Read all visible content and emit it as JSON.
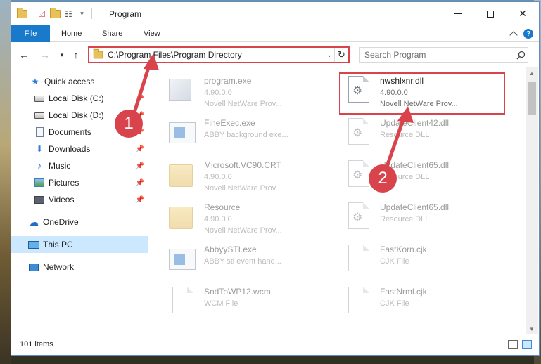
{
  "window": {
    "title": "Program",
    "minimize": "—",
    "maximize": "☐",
    "close": "✕"
  },
  "ribbon": {
    "file": "File",
    "home": "Home",
    "share": "Share",
    "view": "View"
  },
  "address": {
    "path": "C:\\Program Files\\Program Directory",
    "search_placeholder": "Search Program"
  },
  "sidebar": {
    "items": [
      {
        "label": "Quick access",
        "icon": "star-icon"
      },
      {
        "label": "Local Disk (C:)",
        "icon": "disk-icon"
      },
      {
        "label": "Local Disk (D:)",
        "icon": "disk-icon"
      },
      {
        "label": "Documents",
        "icon": "documents-icon"
      },
      {
        "label": "Downloads",
        "icon": "downloads-icon"
      },
      {
        "label": "Music",
        "icon": "music-icon"
      },
      {
        "label": "Pictures",
        "icon": "pictures-icon"
      },
      {
        "label": "Videos",
        "icon": "videos-icon"
      },
      {
        "label": "OneDrive",
        "icon": "cloud-icon"
      },
      {
        "label": "This PC",
        "icon": "computer-icon"
      },
      {
        "label": "Network",
        "icon": "network-icon"
      }
    ]
  },
  "files": [
    {
      "name": "program.exe",
      "line2": "4.90.0.0",
      "line3": "Novell NetWare Prov...",
      "icon": "exe-icon"
    },
    {
      "name": "nwshlxnr.dll",
      "line2": "4.90.0.0",
      "line3": "Novell NetWare Prov...",
      "icon": "dll-icon"
    },
    {
      "name": "FineExec.exe",
      "line2": "ABBY background exe...",
      "line3": "",
      "icon": "app-icon"
    },
    {
      "name": "UpdateClient42.dll",
      "line2": "Resource DLL",
      "line3": "",
      "icon": "dll-icon"
    },
    {
      "name": "Microsoft.VC90.CRT",
      "line2": "4.90.0.0",
      "line3": "Novell NetWare Prov...",
      "icon": "folder-icon"
    },
    {
      "name": "UpdateClient65.dll",
      "line2": "Resource DLL",
      "line3": "",
      "icon": "dll-icon"
    },
    {
      "name": "Resource",
      "line2": "4.90.0.0",
      "line3": "Novell NetWare Prov...",
      "icon": "folder-icon"
    },
    {
      "name": "UpdateClient65.dll",
      "line2": "Resource DLL",
      "line3": "",
      "icon": "dll-icon"
    },
    {
      "name": "AbbyySTI.exe",
      "line2": "ABBY sti event hand...",
      "line3": "",
      "icon": "app-icon"
    },
    {
      "name": "FastKorn.cjk",
      "line2": "CJK File",
      "line3": "",
      "icon": "file-icon"
    },
    {
      "name": "SndToWP12.wcm",
      "line2": "WCM File",
      "line3": "",
      "icon": "file-icon"
    },
    {
      "name": "FastNrml.cjk",
      "line2": "CJK File",
      "line3": "",
      "icon": "file-icon"
    }
  ],
  "status": {
    "items_count": "101 items"
  },
  "annotations": {
    "step1": "1",
    "step2": "2"
  },
  "colors": {
    "accent": "#1979ca",
    "highlight": "#d9434c",
    "selection": "#cce8ff"
  }
}
